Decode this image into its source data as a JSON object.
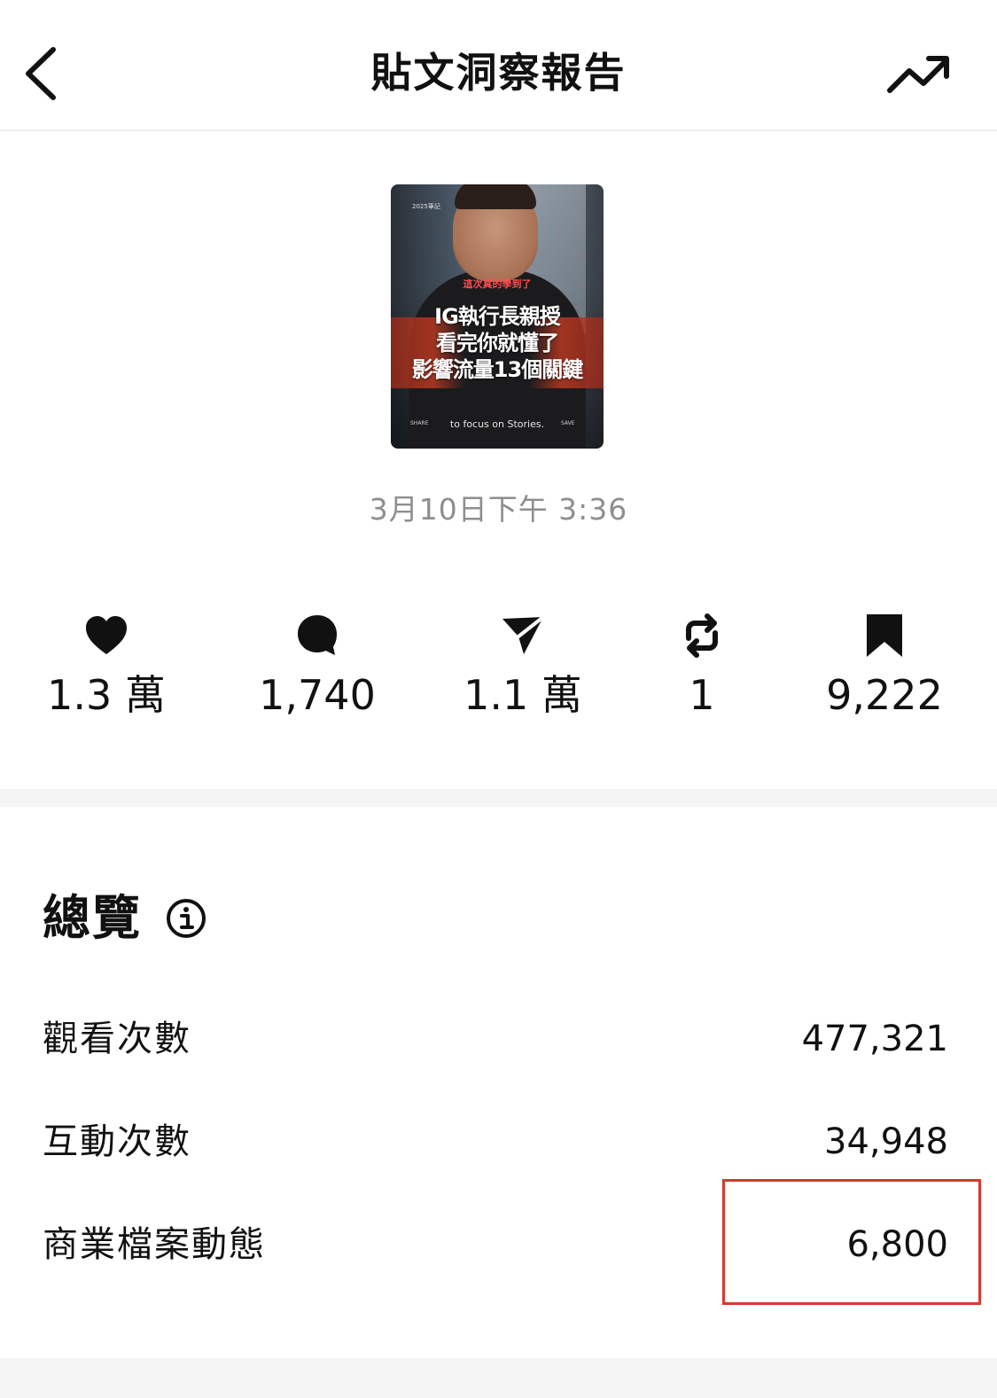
{
  "header": {
    "title": "貼文洞察報告",
    "back_icon": "chevron-left-icon",
    "trend_icon": "trending-up-icon"
  },
  "post": {
    "thumbnail": {
      "top_small": "2025筆記",
      "red_text": "這次真的學到了",
      "line1": "IG執行長親授",
      "line2": "看完你就懂了",
      "line3": "影響流量13個關鍵",
      "caption": "to focus on Stories.",
      "chip_left": "SHARE",
      "chip_right": "SAVE"
    },
    "date": "3月10日下午 3:36"
  },
  "stats": {
    "likes": {
      "icon": "heart-icon",
      "value": "1.3 萬"
    },
    "comments": {
      "icon": "comment-bubble-icon",
      "value": "1,740"
    },
    "shares": {
      "icon": "paper-plane-icon",
      "value": "1.1 萬"
    },
    "reposts": {
      "icon": "repost-icon",
      "value": "1"
    },
    "saves": {
      "icon": "bookmark-icon",
      "value": "9,222"
    }
  },
  "overview": {
    "title": "總覽",
    "info_icon": "info-icon",
    "rows": [
      {
        "label": "觀看次數",
        "value": "477,321"
      },
      {
        "label": "互動次數",
        "value": "34,948"
      },
      {
        "label": "商業檔案動態",
        "value": "6,800"
      }
    ]
  },
  "colors": {
    "text": "#111111",
    "muted": "#8e8e8e",
    "divider": "#efefef",
    "highlight": "#d63a2f"
  }
}
